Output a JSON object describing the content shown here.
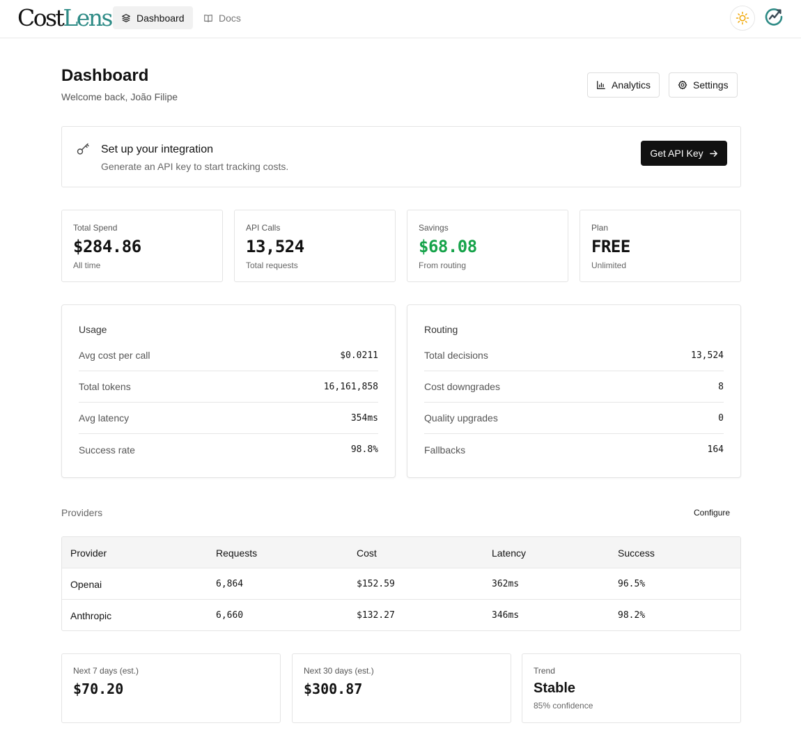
{
  "nav": {
    "logo_part1": "Cost",
    "logo_part2": "Lens",
    "tabs": [
      {
        "label": "Dashboard",
        "icon": "layers-icon",
        "active": true
      },
      {
        "label": "Docs",
        "icon": "book-icon",
        "active": false
      }
    ]
  },
  "header": {
    "title": "Dashboard",
    "subtitle": "Welcome back, João Filipe",
    "analytics_label": "Analytics",
    "settings_label": "Settings"
  },
  "integration": {
    "title": "Set up your integration",
    "description": "Generate an API key to start tracking costs.",
    "button_label": "Get API Key"
  },
  "stats": [
    {
      "label": "Total Spend",
      "value": "$284.86",
      "sub": "All time"
    },
    {
      "label": "API Calls",
      "value": "13,524",
      "sub": "Total requests"
    },
    {
      "label": "Savings",
      "value": "$68.08",
      "sub": "From routing"
    },
    {
      "label": "Plan",
      "value": "FREE",
      "sub": "Unlimited"
    }
  ],
  "usage": {
    "title": "Usage",
    "rows": [
      {
        "key": "Avg cost per call",
        "value": "$0.0211"
      },
      {
        "key": "Total tokens",
        "value": "16,161,858"
      },
      {
        "key": "Avg latency",
        "value": "354ms"
      },
      {
        "key": "Success rate",
        "value": "98.8%"
      }
    ]
  },
  "routing": {
    "title": "Routing",
    "rows": [
      {
        "key": "Total decisions",
        "value": "13,524"
      },
      {
        "key": "Cost downgrades",
        "value": "8"
      },
      {
        "key": "Quality upgrades",
        "value": "0"
      },
      {
        "key": "Fallbacks",
        "value": "164"
      }
    ]
  },
  "providers": {
    "title": "Providers",
    "configure_label": "Configure",
    "columns": [
      "Provider",
      "Requests",
      "Cost",
      "Latency",
      "Success"
    ],
    "rows": [
      [
        "Openai",
        "6,864",
        "$152.59",
        "362ms",
        "96.5%"
      ],
      [
        "Anthropic",
        "6,660",
        "$132.27",
        "346ms",
        "98.2%"
      ]
    ]
  },
  "forecast": [
    {
      "label": "Next 7 days (est.)",
      "value": "$70.20",
      "sub": ""
    },
    {
      "label": "Next 30 days (est.)",
      "value": "$300.87",
      "sub": ""
    },
    {
      "label": "Trend",
      "value": "Stable",
      "sub": "85% confidence"
    }
  ],
  "colors": {
    "accent_green": "#16a34a",
    "logo_teal": "#2e8b86",
    "primary_button": "#111111"
  }
}
